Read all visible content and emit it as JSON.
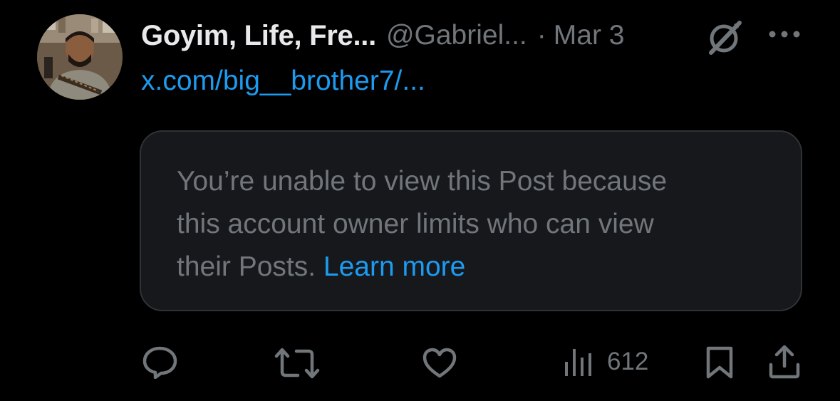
{
  "post": {
    "author": {
      "display_name": "Goyim, Life, Fre...",
      "handle": "@Gabriel...",
      "avatar_icon": "avatar-photo"
    },
    "separator": "·",
    "date": "Mar 3",
    "link": "x.com/big__brother7/...",
    "notice": {
      "line1": "You’re unable to view this Post because",
      "line2": "this account owner limits who can view",
      "line3_prefix": "their Posts.",
      "learn_more": "Learn more"
    },
    "actions": {
      "reply_icon": "reply-icon",
      "repost_icon": "repost-icon",
      "like_icon": "like-icon",
      "views_icon": "views-icon",
      "views_count": "612",
      "bookmark_icon": "bookmark-icon",
      "share_icon": "share-icon"
    }
  },
  "colors": {
    "background": "#000000",
    "primary_text": "#e7e9ea",
    "secondary_text": "#71767b",
    "link": "#1d9bf0",
    "card_background": "#16181c",
    "card_border": "#2f3336"
  }
}
